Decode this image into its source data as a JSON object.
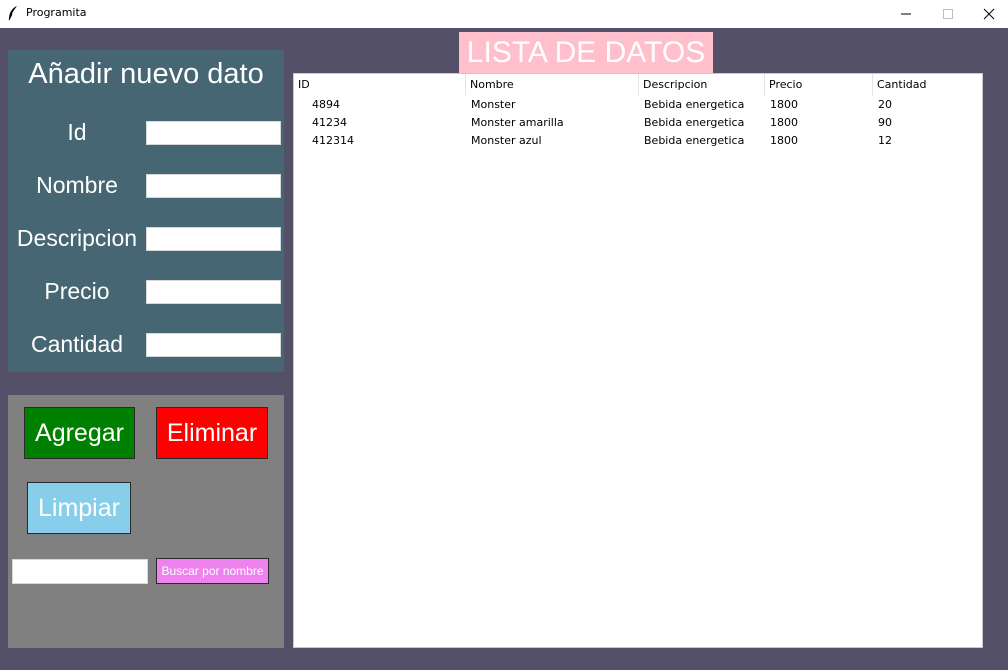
{
  "window": {
    "title": "Programita",
    "icon": "feather-icon",
    "controls": [
      "minimize-icon",
      "maximize-icon",
      "close-icon"
    ]
  },
  "form": {
    "title": "Añadir nuevo dato",
    "fields": [
      {
        "label": "Id",
        "value": ""
      },
      {
        "label": "Nombre",
        "value": ""
      },
      {
        "label": "Descripcion",
        "value": ""
      },
      {
        "label": "Precio",
        "value": ""
      },
      {
        "label": "Cantidad",
        "value": ""
      }
    ]
  },
  "actions": {
    "agregar_label": "Agregar",
    "eliminar_label": "Eliminar",
    "limpiar_label": "Limpiar",
    "search_value": "",
    "buscar_label": "Buscar por nombre"
  },
  "list": {
    "title": "LISTA DE DATOS",
    "columns": [
      "ID",
      "Nombre",
      "Descripcion",
      "Precio",
      "Cantidad"
    ],
    "rows": [
      [
        "4894",
        "Monster",
        "Bebida energetica",
        "1800",
        "20"
      ],
      [
        "41234",
        "Monster amarilla",
        "Bebida energetica",
        "1800",
        "90"
      ],
      [
        "412314",
        "Monster azul",
        "Bebida energetica",
        "1800",
        "12"
      ]
    ]
  },
  "colors": {
    "background": "#535067",
    "form_panel": "#466673",
    "button_panel": "#808080",
    "agregar": "#008000",
    "eliminar": "#ff0000",
    "limpiar": "#87ceeb",
    "buscar": "#ee82ee",
    "list_title": "#ffc0cb"
  }
}
